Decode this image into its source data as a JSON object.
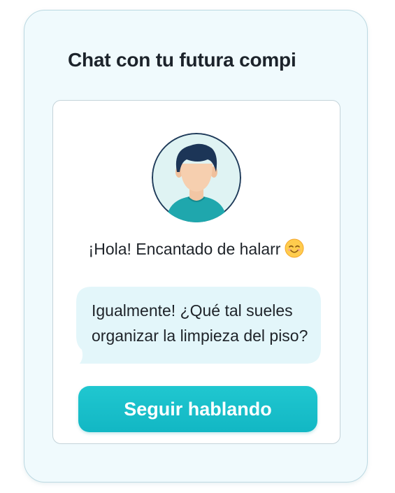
{
  "chat": {
    "title": "Chat con tu futura compi",
    "greeting": "¡Hola! Encantado de halarr",
    "greeting_emoji": "smiling-face-icon",
    "reply": "Igualmente! ¿Qué tal sueles\norganizar la limpieza del piso?",
    "cta_label": "Seguir hablando"
  },
  "colors": {
    "accent": "#14bcc8",
    "bubble": "#e3f6fa",
    "outer_card": "#f0fafd"
  },
  "icons": {
    "avatar": "person-avatar-icon",
    "emoji": "smiling-face-icon"
  }
}
